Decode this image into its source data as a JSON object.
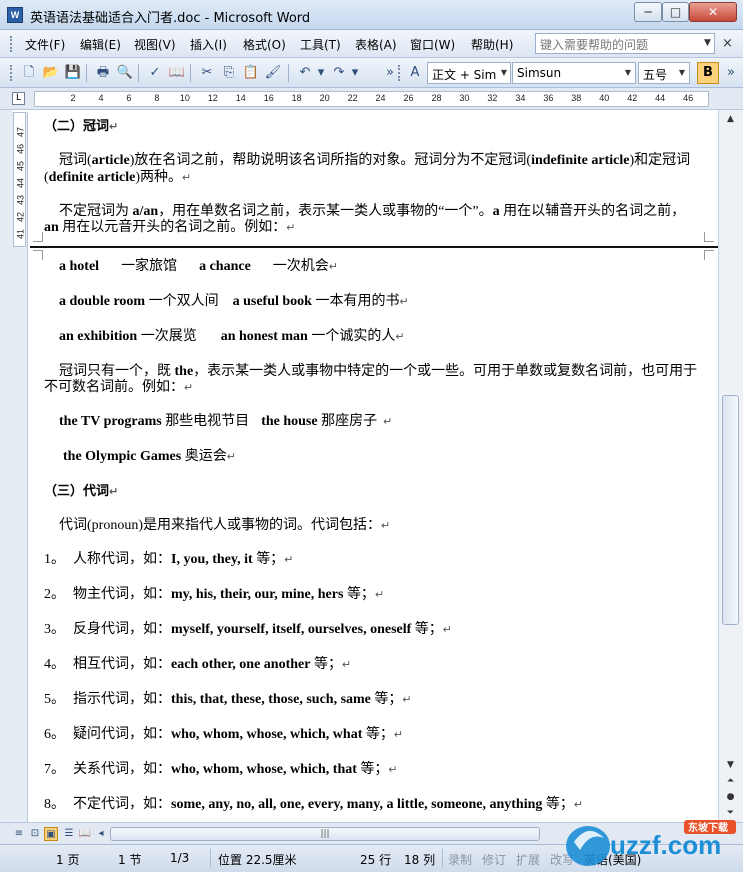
{
  "window": {
    "title": "英语语法基础适合入门者.doc - Microsoft Word",
    "app_icon": "W",
    "minimize": "─",
    "maximize": "□",
    "close": "✕"
  },
  "menu": {
    "items": [
      "文件(F)",
      "编辑(E)",
      "视图(V)",
      "插入(I)",
      "格式(O)",
      "工具(T)",
      "表格(A)",
      "窗口(W)",
      "帮助(H)"
    ],
    "help_placeholder": "键入需要帮助的问题",
    "close_doc": "×"
  },
  "toolbar": {
    "style_value": "正文 + Sim",
    "font_value": "Simsun",
    "size_value": "五号",
    "bold_label": "B"
  },
  "ruler": {
    "numbers": [
      "2",
      "4",
      "6",
      "8",
      "10",
      "12",
      "14",
      "16",
      "18",
      "20",
      "22",
      "24",
      "26",
      "28",
      "30",
      "32",
      "34",
      "36",
      "38",
      "40",
      "42",
      "44",
      "46"
    ],
    "corner": "L"
  },
  "vruler": {
    "numbers": [
      "41",
      "42",
      "43",
      "44",
      "45",
      "46",
      "47"
    ]
  },
  "document": {
    "heading_article": "（二）冠词",
    "para1_a": "冠词(",
    "para1_b": "article",
    "para1_c": ")放在名词之前，帮助说明该名词所指的对象。冠词分为不定冠词(",
    "para1_d": "indefinite article",
    "para1_e": ")和定冠词",
    "para1_line2_a": "(",
    "para1_line2_b": "definite article",
    "para1_line2_c": ")两种。",
    "para2_a": "不定冠词为 ",
    "para2_b": "a/an",
    "para2_c": "，用在单数名词之前，表示某一类人或事物的“一个”。",
    "para2_d": "a",
    "para2_e": " 用在以辅音开头的名词之前，",
    "para2_line2_a": "an",
    "para2_line2_b": " 用在以元音开头的名词之前。例如：",
    "ex1_a": "a hotel",
    "ex1_b": "一家旅馆",
    "ex1_c": "a chance",
    "ex1_d": "一次机会",
    "ex2_a": "a double room",
    "ex2_b": " 一个双人间",
    "ex2_c": "a useful book",
    "ex2_d": " 一本有用的书",
    "ex3_a": "an exhibition",
    "ex3_b": " 一次展览",
    "ex3_c": "an honest man",
    "ex3_d": " 一个诚实的人",
    "para3_a": "冠词只有一个，既 ",
    "para3_b": "the",
    "para3_c": "，表示某一类人或事物中特定的一个或一些。可用于单数或复数名词前，也可用于",
    "para3_line2": "不可数名词前。例如：",
    "ex4_a": "the TV programs",
    "ex4_b": " 那些电视节目",
    "ex4_c": "the house",
    "ex4_d": " 那座房子",
    "ex5_a": "the Olympic Games",
    "ex5_b": " 奥运会",
    "heading_pronoun": "（三）代词",
    "para4_a": "代词(",
    "para4_b": "pronoun",
    "para4_c": ")是用来指代人或事物的词。代词包括：",
    "list": [
      {
        "num": "1。",
        "label": "人称代词，如：",
        "words": "I, you, they, it",
        "tail": " 等；"
      },
      {
        "num": "2。",
        "label": "物主代词，如：",
        "words": "my, his, their, our, mine, hers",
        "tail": " 等；"
      },
      {
        "num": "3。",
        "label": "反身代词，如：",
        "words": "myself, yourself, itself, ourselves, oneself",
        "tail": " 等；"
      },
      {
        "num": "4。",
        "label": "相互代词，如：",
        "words": "each other, one another",
        "tail": " 等；"
      },
      {
        "num": "5。",
        "label": "指示代词，如：",
        "words": "this, that, these, those, such, same",
        "tail": " 等；"
      },
      {
        "num": "6。",
        "label": "疑问代词，如：",
        "words": "who, whom, whose, which, what",
        "tail": " 等；"
      },
      {
        "num": "7。",
        "label": "关系代词，如：",
        "words": "who, whom, whose, which, that",
        "tail": " 等；"
      },
      {
        "num": "8。",
        "label": "不定代词，如：",
        "words": "some, any, no, all, one, every, many, a little, someone, anything",
        "tail": " 等；"
      }
    ],
    "para_mark": "↵"
  },
  "status": {
    "page": "1 页",
    "section": "1 节",
    "pages": "1/3",
    "position": "位置 22.5厘米",
    "line": "25 行",
    "column": "18 列",
    "rec": "录制",
    "trk": "修订",
    "ext": "扩展",
    "ovr": "改写",
    "language": "英语(美国)"
  },
  "watermark": {
    "brand": "uzzf.com",
    "sub": "东坡下载"
  },
  "colors": {
    "chrome": "#dce6f3",
    "accent": "#fbd27a",
    "close_red": "#c8483a"
  }
}
